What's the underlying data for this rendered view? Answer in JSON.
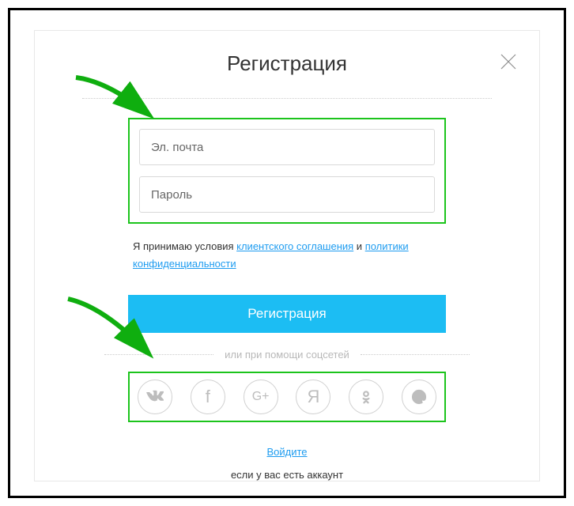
{
  "title": "Регистрация",
  "fields": {
    "email_placeholder": "Эл. почта",
    "password_placeholder": "Пароль"
  },
  "terms": {
    "prefix": "Я принимаю условия ",
    "link1": "клиентского соглашения",
    "mid": " и ",
    "link2": "политики конфиденциальности"
  },
  "submit_label": "Регистрация",
  "divider_label": "или при помощи соцсетей",
  "social": {
    "vk": "VK",
    "fb": "Facebook",
    "gplus": "Google+",
    "yandex": "Я",
    "ok": "Odnoklassniki",
    "mailru": "Mail.ru"
  },
  "login_link": "Войдите",
  "has_account": "если у вас есть аккаунт"
}
